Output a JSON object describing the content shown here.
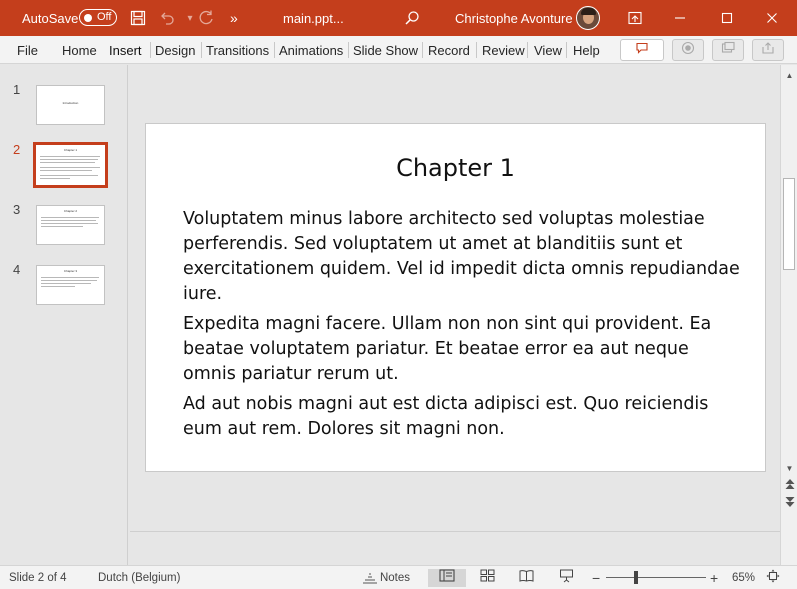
{
  "titlebar": {
    "autosave_label": "AutoSave",
    "autosave_state": "Off",
    "doc_name": "main.ppt...",
    "user_name": "Christophe Avonture",
    "overflow": "»",
    "bg_color": "#c43e1c",
    "icons": [
      "save-icon",
      "undo-icon",
      "redo-icon",
      "search-icon",
      "ribbon-display-icon",
      "minimize-icon",
      "maximize-icon",
      "close-icon"
    ]
  },
  "menu": {
    "items": [
      "File",
      "Home",
      "Insert",
      "Design",
      "Transitions",
      "Animations",
      "Slide Show",
      "Record",
      "Review",
      "View",
      "Help"
    ],
    "active": "Insert"
  },
  "thumbnails": [
    {
      "num": "1",
      "title": "Introduction",
      "selected": false
    },
    {
      "num": "2",
      "title": "Chapter 1",
      "selected": true
    },
    {
      "num": "3",
      "title": "Chapter 2",
      "selected": false
    },
    {
      "num": "4",
      "title": "Chapter 3",
      "selected": false
    }
  ],
  "slide": {
    "title": "Chapter 1",
    "paragraphs": [
      "Voluptatem minus labore architecto sed voluptas molestiae perferendis. Sed voluptatem ut amet at blanditiis sunt et exercitationem quidem. Vel id impedit dicta omnis repudiandae iure.",
      "Expedita magni facere. Ullam non non sint qui provident. Ea beatae voluptatem pariatur. Et beatae error ea aut neque omnis pariatur rerum ut.",
      "Ad aut nobis magni aut est dicta adipisci est. Quo reiciendis eum aut rem. Dolores sit magni non."
    ]
  },
  "statusbar": {
    "slide_info": "Slide 2 of 4",
    "language": "Dutch (Belgium)",
    "notes_label": "Notes",
    "zoom_minus": "−",
    "zoom_plus": "+",
    "zoom": "65%",
    "zoom_fraction": 0.3
  }
}
